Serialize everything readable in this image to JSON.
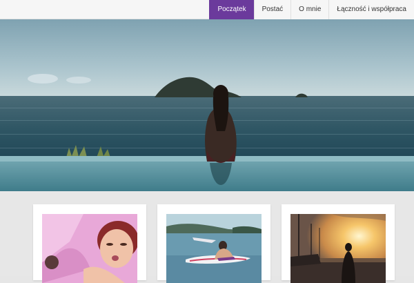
{
  "nav": {
    "items": [
      {
        "label": "Początek",
        "active": true
      },
      {
        "label": "Postać",
        "active": false
      },
      {
        "label": "O mnie",
        "active": false
      },
      {
        "label": "Łączność i współpraca",
        "active": false
      }
    ]
  },
  "colors": {
    "accent": "#6b3a9c",
    "page_bg": "#e7e7e7",
    "topbar_bg": "#f6f6f6"
  },
  "hero": {
    "image": "woman-in-infinity-pool-facing-sea-island"
  },
  "gallery": {
    "cards": [
      {
        "image": "woman-lying-on-pink-fabric"
      },
      {
        "image": "paddleboard-on-lake"
      },
      {
        "image": "harbor-sunset-silhouette"
      }
    ]
  }
}
